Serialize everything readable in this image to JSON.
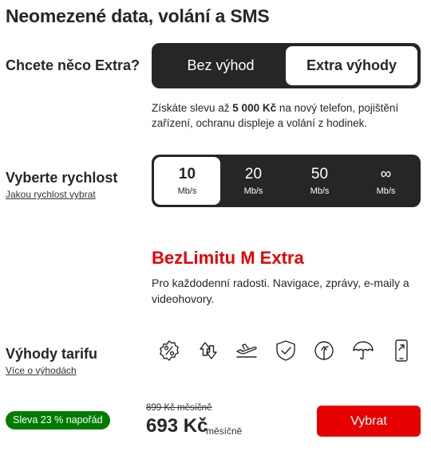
{
  "title": "Neomezené data, volání a SMS",
  "extra": {
    "label": "Chcete něco Extra?",
    "option_without": "Bez výhod",
    "option_with": "Extra výhody",
    "selected": "Extra výhody",
    "desc_before": "Získáte slevu až ",
    "desc_bold": "5 000 Kč",
    "desc_after": " na nový telefon, pojištění zařízení, ochranu displeje a volání z hodinek."
  },
  "speed": {
    "label": "Vyberte rychlost",
    "help_link": "Jakou rychlost vybrat",
    "options": [
      {
        "value": "10",
        "unit": "Mb/s"
      },
      {
        "value": "20",
        "unit": "Mb/s"
      },
      {
        "value": "50",
        "unit": "Mb/s"
      },
      {
        "value": "∞",
        "unit": "Mb/s"
      }
    ],
    "selected": "10"
  },
  "plan": {
    "name": "BezLimitu M Extra",
    "description": "Pro každodenní radosti. Navigace, zprávy, e-maily a videohovory."
  },
  "benefits": {
    "label": "Výhody tarifu",
    "more_link": "Více o výhodách",
    "icons": [
      "discount-badge-icon",
      "data-transfer-icon",
      "airplane-icon",
      "shield-check-icon",
      "sim-card-icon",
      "umbrella-icon",
      "phone-screen-icon"
    ]
  },
  "pricing": {
    "badge": "Sleva 23 % napořád",
    "old_price": "899 Kč měsíčně",
    "price": "693 Kč",
    "price_unit": "měsíčně",
    "buy_label": "Vybrat"
  },
  "colors": {
    "accent_red": "#e60000",
    "dark": "#262626",
    "badge_green": "#007c00"
  }
}
